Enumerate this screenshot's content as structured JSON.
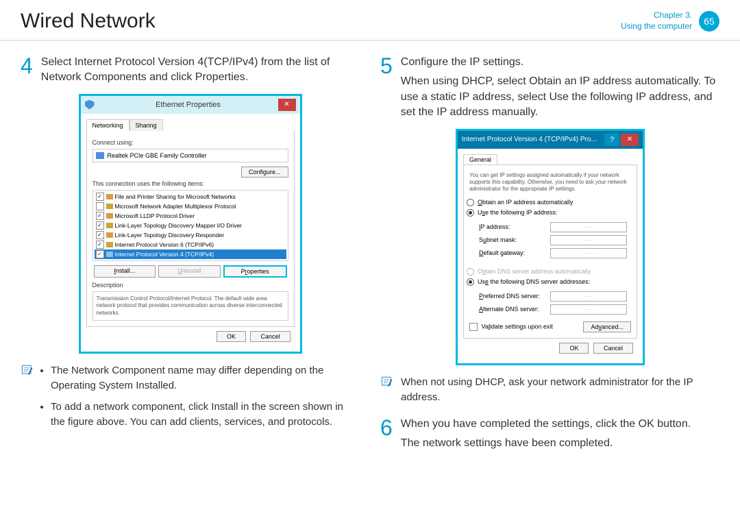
{
  "header": {
    "title": "Wired Network",
    "chapter": "Chapter 3.",
    "section": "Using the computer",
    "page": "65"
  },
  "step4": {
    "num": "4",
    "text_a": "Select ",
    "text_b": "Internet Protocol Version 4(TCP/IPv4)",
    "text_c": " from the list of Network Components and click ",
    "text_d": "Properties",
    "text_e": "."
  },
  "dialog1": {
    "title": "Ethernet Properties",
    "tab1": "Networking",
    "tab2": "Sharing",
    "connect_using": "Connect using:",
    "adapter": "Realtek PCIe GBE Family Controller",
    "configure": "Configure...",
    "uses_items": "This connection uses the following items:",
    "items": [
      "File and Printer Sharing for Microsoft Networks",
      "Microsoft Network Adapter Multiplexor Protocol",
      "Microsoft LLDP Protocol Driver",
      "Link-Layer Topology Discovery Mapper I/O Driver",
      "Link-Layer Topology Discovery Responder",
      "Internet Protocol Version 6 (TCP/IPv6)",
      "Internet Protocol Version 4 (TCP/IPv4)"
    ],
    "install": "Install...",
    "uninstall": "Uninstall",
    "properties": "Properties",
    "desc_label": "Description",
    "desc": "Transmission Control Protocol/Internet Protocol. The default wide area network protocol that provides communication across diverse interconnected networks.",
    "ok": "OK",
    "cancel": "Cancel"
  },
  "note1": {
    "bullet1": "The Network Component name may differ depending on the Operating System Installed.",
    "bullet2": "To add a network component, click Install in the screen shown in the figure above. You can add clients, services, and protocols."
  },
  "step5": {
    "num": "5",
    "line1": "Configure the IP settings.",
    "line2a": "When using DHCP, select ",
    "line2b": "Obtain an IP address automatically",
    "line2c": ". To use a static IP address, select ",
    "line2d": "Use the following IP address",
    "line2e": ", and set the IP address manually."
  },
  "dialog2": {
    "title": "Internet Protocol Version 4 (TCP/IPv4) Pro...",
    "tab": "General",
    "info": "You can get IP settings assigned automatically if your network supports this capability. Otherwise, you need to ask your network administrator for the appropriate IP settings.",
    "r1": "Obtain an IP address automatically",
    "r2": "Use the following IP address:",
    "ip_label": "IP address:",
    "subnet_label": "Subnet mask:",
    "gateway_label": "Default gateway:",
    "r3": "Obtain DNS server address automatically",
    "r4": "Use the following DNS server addresses:",
    "pdns": "Preferred DNS server:",
    "adns": "Alternate DNS server:",
    "dots": ".       .       .",
    "validate": "Validate settings upon exit",
    "advanced": "Advanced...",
    "ok": "OK",
    "cancel": "Cancel"
  },
  "note2": {
    "text": "When not using DHCP, ask your network administrator for the IP address."
  },
  "step6": {
    "num": "6",
    "line1a": "When you have completed the settings, click the ",
    "line1b": "OK",
    "line1c": " button.",
    "line2": "The network settings have been completed."
  }
}
